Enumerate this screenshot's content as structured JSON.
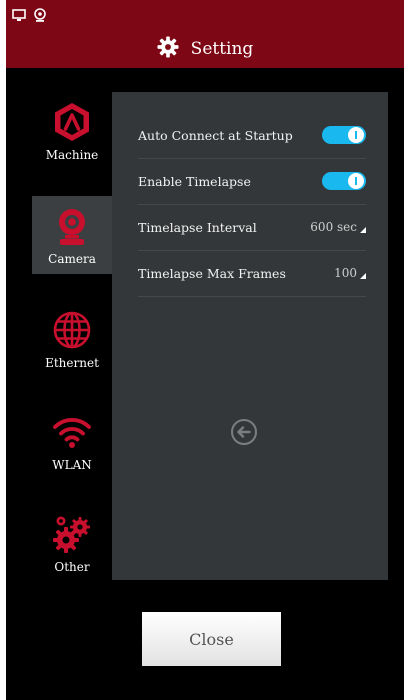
{
  "header": {
    "title": "Setting"
  },
  "status_icons": [
    "monitor-icon",
    "webcam-icon"
  ],
  "sidebar": {
    "items": [
      {
        "label": "Machine",
        "icon": "machine-icon",
        "active": false
      },
      {
        "label": "Camera",
        "icon": "camera-icon",
        "active": true
      },
      {
        "label": "Ethernet",
        "icon": "globe-icon",
        "active": false
      },
      {
        "label": "WLAN",
        "icon": "wifi-icon",
        "active": false
      },
      {
        "label": "Other",
        "icon": "gears-icon",
        "active": false
      }
    ]
  },
  "settings": {
    "rows": [
      {
        "label": "Auto Connect at Startup",
        "type": "toggle",
        "on": true
      },
      {
        "label": "Enable Timelapse",
        "type": "toggle",
        "on": true
      },
      {
        "label": "Timelapse Interval",
        "type": "value",
        "value": "600 sec"
      },
      {
        "label": "Timelapse Max Frames",
        "type": "value",
        "value": "100"
      }
    ]
  },
  "footer": {
    "close_label": "Close"
  },
  "colors": {
    "accent": "#c8102e",
    "header": "#7d0715",
    "toggle": "#19b8ef",
    "panel": "#343739"
  }
}
